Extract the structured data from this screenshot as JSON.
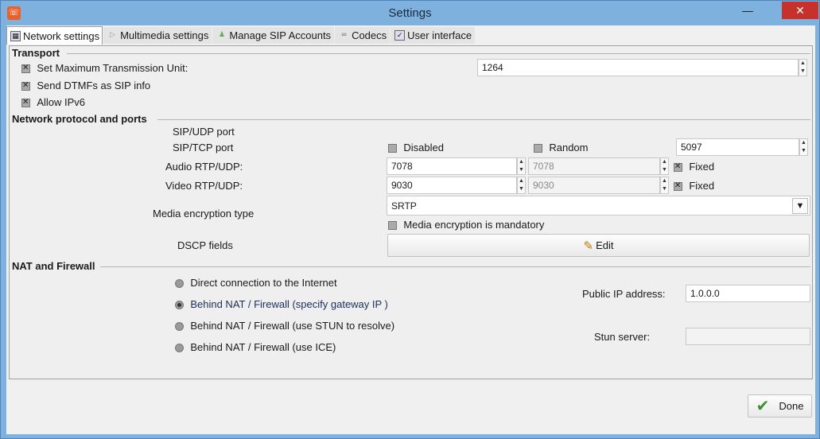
{
  "window": {
    "title": "Settings",
    "close_glyph": "✕",
    "min_glyph": "—",
    "app_icon": "sip-phone-icon"
  },
  "tabs": [
    {
      "label": "Network settings"
    },
    {
      "label": "Multimedia settings"
    },
    {
      "label": "Manage SIP Accounts"
    },
    {
      "label": "Codecs"
    },
    {
      "label": "User interface"
    }
  ],
  "transport": {
    "title": "Transport",
    "mtu_label": "Set Maximum Transmission Unit:",
    "mtu_value": "1264",
    "dtmf_label": "Send DTMFs as SIP info",
    "ipv6_label": "Allow IPv6"
  },
  "network": {
    "title": "Network protocol and ports",
    "sip_udp_label": "SIP/UDP port",
    "sip_tcp_label": "SIP/TCP port",
    "disabled_label": "Disabled",
    "random_label": "Random",
    "sip_port_value": "5097",
    "audio_label": "Audio RTP/UDP:",
    "audio_min": "7078",
    "audio_max": "7078",
    "video_label": "Video RTP/UDP:",
    "video_min": "9030",
    "video_max": "9030",
    "fixed_label": "Fixed",
    "encryption_label": "Media encryption type",
    "encryption_value": "SRTP",
    "encryption_mandatory_label": "Media encryption is mandatory",
    "dscp_label": "DSCP fields",
    "edit_label": "Edit"
  },
  "nat": {
    "title": "NAT and Firewall",
    "options": [
      {
        "label": "Direct connection to the Internet"
      },
      {
        "label": "Behind NAT / Firewall (specify gateway IP )"
      },
      {
        "label": "Behind NAT / Firewall (use STUN to resolve)"
      },
      {
        "label": "Behind NAT / Firewall (use ICE)"
      }
    ],
    "public_ip_label": "Public IP address:",
    "public_ip_value": "1.0.0.0",
    "stun_label": "Stun server:",
    "stun_value": ""
  },
  "footer": {
    "done_label": "Done"
  },
  "colors": {
    "titlebar": "#7fb1de",
    "close": "#c7312b",
    "accent": "#3a8f2c"
  }
}
